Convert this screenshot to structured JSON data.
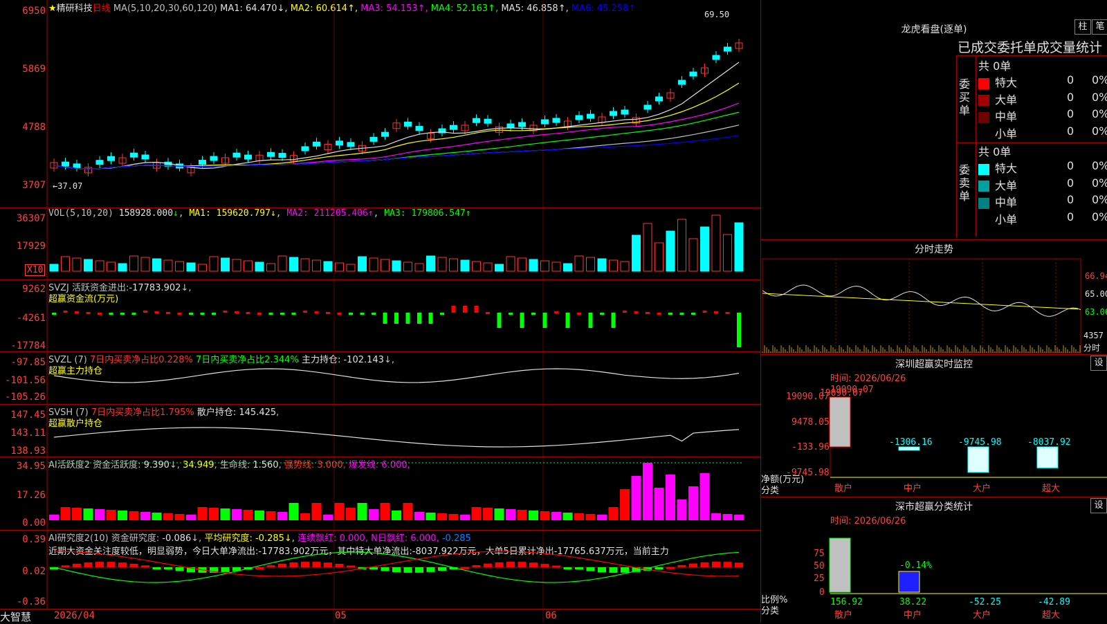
{
  "stock": {
    "name": "精研科技",
    "period": "日线",
    "star": "★"
  },
  "brand": "大智慧",
  "main": {
    "ma_header": "MA(5,10,20,30,60,120)",
    "ma_values": [
      {
        "label": "MA1:",
        "value": "64.470",
        "arrow": "↓",
        "color": "#e0e0e0"
      },
      {
        "label": "MA2:",
        "value": "60.614",
        "arrow": "↑",
        "color": "#ffff00"
      },
      {
        "label": "MA3:",
        "value": "54.153",
        "arrow": "↑",
        "color": "#ff00ff"
      },
      {
        "label": "MA4:",
        "value": "52.163",
        "arrow": "↑",
        "color": "#00ff00"
      },
      {
        "label": "MA5:",
        "value": "46.858",
        "arrow": "↑",
        "color": "#e0e0e0"
      },
      {
        "label": "MA6:",
        "value": "45.258",
        "arrow": "↑",
        "color": "#0000ff"
      }
    ],
    "yticks": [
      "6950",
      "5869",
      "4788",
      "3707"
    ],
    "high_label": "69.50",
    "low_label": "←37.07"
  },
  "vol": {
    "header": "VOL(5,10,20)",
    "v": "158928.000",
    "ma1": "159620.797",
    "ma2": "211205.406",
    "ma3": "179806.547",
    "yticks": [
      "36307",
      "17929"
    ],
    "unit": "X10"
  },
  "svzj": {
    "header": "SVZJ",
    "label": "活跃资金进出:",
    "value": "-17783.902",
    "sub": "超赢资金流(万元)",
    "yticks": [
      "9262",
      "-4261",
      "-17784"
    ]
  },
  "svzl": {
    "header": "SVZL (7)",
    "p1": "7日内买卖净占比0.228%",
    "p2": "7日内买卖净占比2.344%",
    "label": "主力持仓:",
    "value": "-102.143",
    "sub": "超赢主力持仓",
    "yticks": [
      "-97.85",
      "-101.56",
      "-105.26"
    ]
  },
  "svsh": {
    "header": "SVSH (7)",
    "p1": "7日内买卖净占比1.795%",
    "label": "散户持仓:",
    "value": "145.425",
    "sub": "超赢散户持仓",
    "yticks": [
      "147.45",
      "143.11",
      "138.93"
    ]
  },
  "ai2": {
    "header": "AI活跃度2",
    "l1": "资金活跃度:",
    "v1": "9.390",
    "v2": "34.949",
    "l3": "生命线:",
    "v3": "1.560",
    "l4": "强势线:",
    "v4": "3.000",
    "l5": "爆发线:",
    "v5": "6.000",
    "yticks": [
      "34.95",
      "17.26",
      "0.00"
    ]
  },
  "ai_research": {
    "header": "AI研究度2(10)",
    "l1": "资金研究度:",
    "v1": "-0.086",
    "l2": "平均研究度:",
    "v2": "-0.285",
    "l3": "连续飘红:",
    "v3": "0.000",
    "l4": "N日飘红:",
    "v4": "6.000",
    "v5": "-0.285",
    "commentary": "近期大资金关注度较低，明显弱势，今日大单净流出:-17783.902万元，其中特大单净流出:-8037.922万元，大单5日累计净出-17765.637万元，当前主力",
    "yticks": [
      "0.39",
      "0.02",
      "-0.36"
    ]
  },
  "dates": {
    "d1": "2026/04",
    "d2": "05",
    "d3": "06"
  },
  "lhb": {
    "title": "龙虎看盘(逐单)",
    "btn_bar": "柱",
    "btn_pen": "笔",
    "subtitle": "已成交委托单成交量统计",
    "buy": {
      "side": "委买单",
      "total": "共 0单",
      "rows": [
        {
          "n": "特大",
          "c": "#ff0000",
          "q": "0",
          "p": "0%"
        },
        {
          "n": "大单",
          "c": "#a00000",
          "q": "0",
          "p": "0%"
        },
        {
          "n": "中单",
          "c": "#700000",
          "q": "0",
          "p": "0%"
        },
        {
          "n": "小单",
          "c": "#000000",
          "q": "0",
          "p": "0%"
        }
      ]
    },
    "sell": {
      "side": "委卖单",
      "total": "共 0单",
      "rows": [
        {
          "n": "特大",
          "c": "#00ffff",
          "q": "0",
          "p": "0%"
        },
        {
          "n": "大单",
          "c": "#00a0a0",
          "q": "0",
          "p": "0%"
        },
        {
          "n": "中单",
          "c": "#008080",
          "q": "0",
          "p": "0%"
        },
        {
          "n": "小单",
          "c": "#000000",
          "q": "0",
          "p": "0%"
        }
      ]
    }
  },
  "fenshi": {
    "title": "分时走势",
    "yticks": [
      "66.94",
      "65.00",
      "63.06"
    ],
    "vol": "4357",
    "unit": "分时"
  },
  "monitor": {
    "title": "深圳超赢实时监控",
    "btn": "设",
    "time": "时间: 2026/06/26",
    "top": "19090.07",
    "yticks": [
      "19090.07",
      "9478.05",
      "-133.96",
      "-9745.98"
    ],
    "bars": [
      {
        "cat": "散户",
        "v": 19090.07,
        "lab": "19090.07",
        "lc": "#ff4040"
      },
      {
        "cat": "中户",
        "v": -1306.16,
        "lab": "-1306.16",
        "lc": "#00ffff"
      },
      {
        "cat": "大户",
        "v": -9745.98,
        "lab": "-9745.98",
        "lc": "#00ffff"
      },
      {
        "cat": "超大",
        "v": -8037.92,
        "lab": "-8037.92",
        "lc": "#00ffff"
      }
    ],
    "ylabel": "净额(万元)",
    "xlabel": "分类"
  },
  "classify": {
    "title": "深市超赢分类统计",
    "btn": "设",
    "time": "时间: 2026/06/26",
    "peak": "-0.14%",
    "yticks": [
      "75",
      "50",
      "25",
      "0"
    ],
    "bars": [
      {
        "cat": "散户",
        "lab": "156.92",
        "lc": "#00ff00"
      },
      {
        "cat": "中户",
        "lab": "38.22",
        "lc": "#00ff00"
      },
      {
        "cat": "大户",
        "lab": "-52.25",
        "lc": "#00ffff"
      },
      {
        "cat": "超大",
        "lab": "-42.89",
        "lc": "#00ffff"
      }
    ],
    "ylabel": "比例%",
    "xlabel": "分类"
  },
  "colors": {
    "up": "#ff3232",
    "down": "#00ffff",
    "grid": "#a00000"
  }
}
